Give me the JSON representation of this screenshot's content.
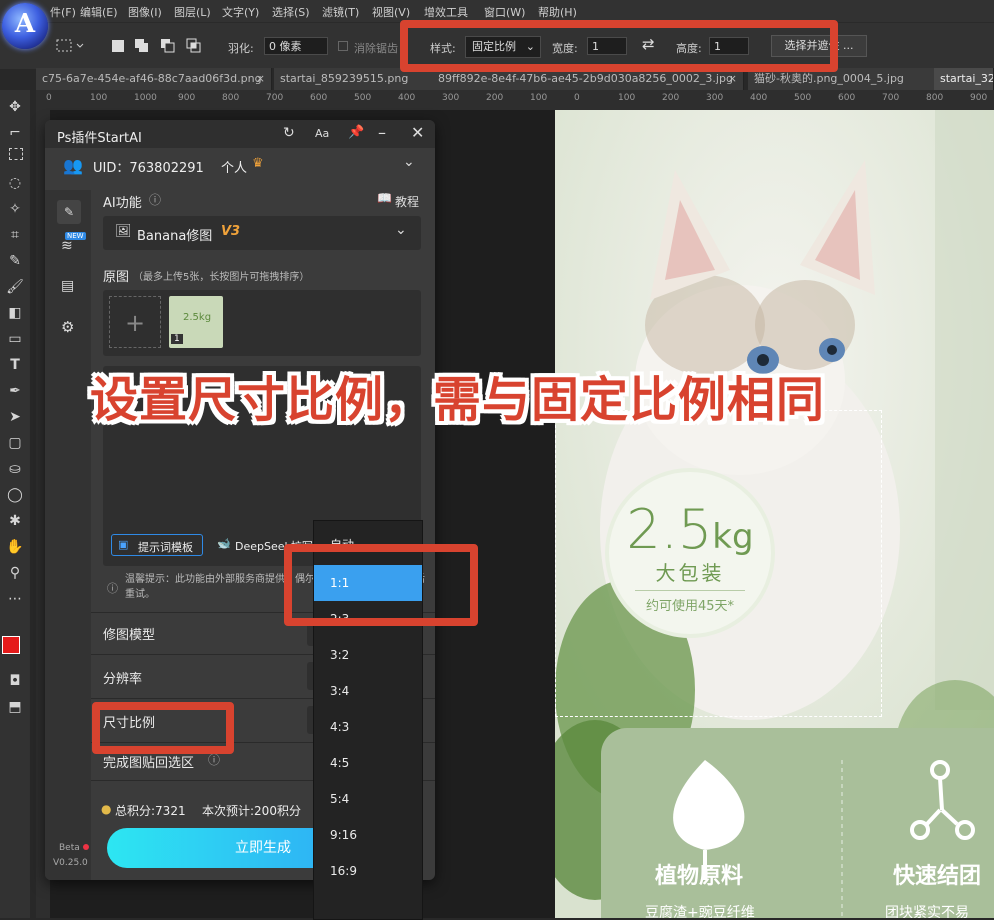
{
  "app": {
    "logo_letter": "A",
    "menu": [
      "件(F)",
      "编辑(E)",
      "图像(I)",
      "图层(L)",
      "文字(Y)",
      "选择(S)",
      "滤镜(T)",
      "视图(V)",
      "增效工具",
      "窗口(W)",
      "帮助(H)"
    ]
  },
  "options_bar": {
    "feather_label": "羽化:",
    "feather_value": "0 像素",
    "antialias_label": "消除锯齿",
    "style_label": "样式:",
    "style_value": "固定比例",
    "width_label": "宽度:",
    "width_value": "1",
    "height_label": "高度:",
    "height_value": "1",
    "select_mask_label": "选择并遮住 ..."
  },
  "tabs": [
    {
      "label": "c75-6a7e-454e-af46-88c7aad06f3d.png",
      "active": false
    },
    {
      "label": "startai_859239515.png",
      "active": false
    },
    {
      "label": "89ff892e-8e4f-47b6-ae45-2b9d030a8256_0002_3.jpg",
      "active": false
    },
    {
      "label": "猫砂-秋奥的.png_0004_5.jpg",
      "active": false
    },
    {
      "label": "startai_32",
      "active": true
    }
  ],
  "ruler_ticks": [
    "0",
    "100",
    "1000",
    "900",
    "800",
    "700",
    "600",
    "500",
    "400",
    "300",
    "200",
    "100",
    "0",
    "100",
    "200",
    "300",
    "400",
    "500",
    "600",
    "700",
    "800",
    "900"
  ],
  "plugin": {
    "title": "Ps插件StartAI",
    "uid_label": "UID：763802291",
    "account_type": "个人",
    "ai_function_label": "AI功能",
    "tutorial_label": "教程",
    "model_name": "Banana修图",
    "model_version": "V3",
    "source_label": "原图",
    "source_hint": "（最多上传5张，长按图片可拖拽排序）",
    "thumb_badge": "1",
    "thumb_text": "2.5kg",
    "prompt_template_label": "提示词模板",
    "deepseek_label": "DeepSeek扩写",
    "notice": "温馨提示：此功能由外部服务商提供，偶尔会出现使用问题，请稍后重试。",
    "rows": [
      "修图模型",
      "分辨率",
      "尺寸比例",
      "完成图贴回选区"
    ],
    "points_label": "总积分:7321",
    "estimate_label": "本次预计:200积分",
    "generate_label": "立即生成",
    "beta_label": "Beta",
    "version_label": "V0.25.0",
    "side_badge": "NEW"
  },
  "ratio_dropdown": {
    "options": [
      "自动",
      "1:1",
      "2:3",
      "3:2",
      "3:4",
      "4:3",
      "4:5",
      "5:4",
      "9:16",
      "16:9"
    ],
    "selected": "1:1"
  },
  "annotation_banner": "设置尺寸比例，需与固定比例相同",
  "poster": {
    "weight": "2.5",
    "weight_unit": "kg",
    "big_pack": "大包装",
    "usage": "约可使用45天*",
    "feature1_title": "植物原料",
    "feature1_sub": "豆腐渣+豌豆纤维",
    "feature2_title": "快速结团",
    "feature2_sub": "团块紧实不易"
  },
  "colors": {
    "annotation_red": "#d8432f",
    "selected_option": "#3aa0ef",
    "generate_gradient_start": "#2de6f2",
    "generate_gradient_end": "#2f9df5",
    "foreground": "#e51b1b",
    "background": "#ffffff"
  }
}
